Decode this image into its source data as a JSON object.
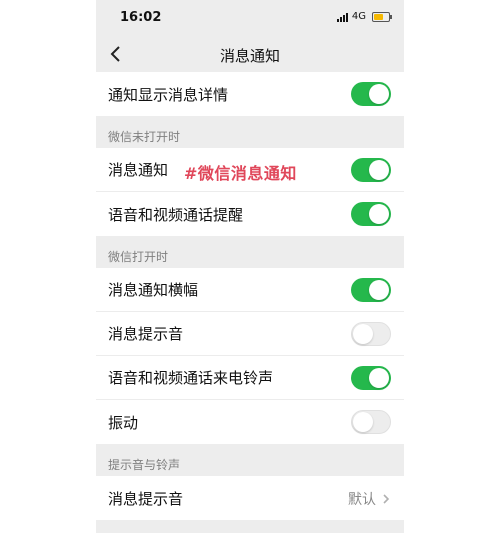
{
  "status_bar": {
    "time": "16:02",
    "network": "4G"
  },
  "nav": {
    "title": "消息通知"
  },
  "rows": {
    "show_details": {
      "label": "通知显示消息详情",
      "on": true
    }
  },
  "sections": {
    "closed": {
      "header": "微信未打开时",
      "items": [
        {
          "label": "消息通知",
          "on": true
        },
        {
          "label": "语音和视频通话提醒",
          "on": true
        }
      ]
    },
    "open": {
      "header": "微信打开时",
      "items": [
        {
          "label": "消息通知横幅",
          "on": true
        },
        {
          "label": "消息提示音",
          "on": false
        },
        {
          "label": "语音和视频通话来电铃声",
          "on": true
        },
        {
          "label": "振动",
          "on": false
        }
      ]
    },
    "sound": {
      "header": "提示音与铃声",
      "items": [
        {
          "label": "消息提示音",
          "value": "默认"
        }
      ]
    }
  },
  "watermark": "#微信消息通知",
  "colors": {
    "toggle_on": "#25b84c",
    "watermark": "#e0475a",
    "battery": "#f5b800"
  },
  "icons": {
    "back": "chevron-left-icon",
    "disclosure": "chevron-right-icon"
  }
}
